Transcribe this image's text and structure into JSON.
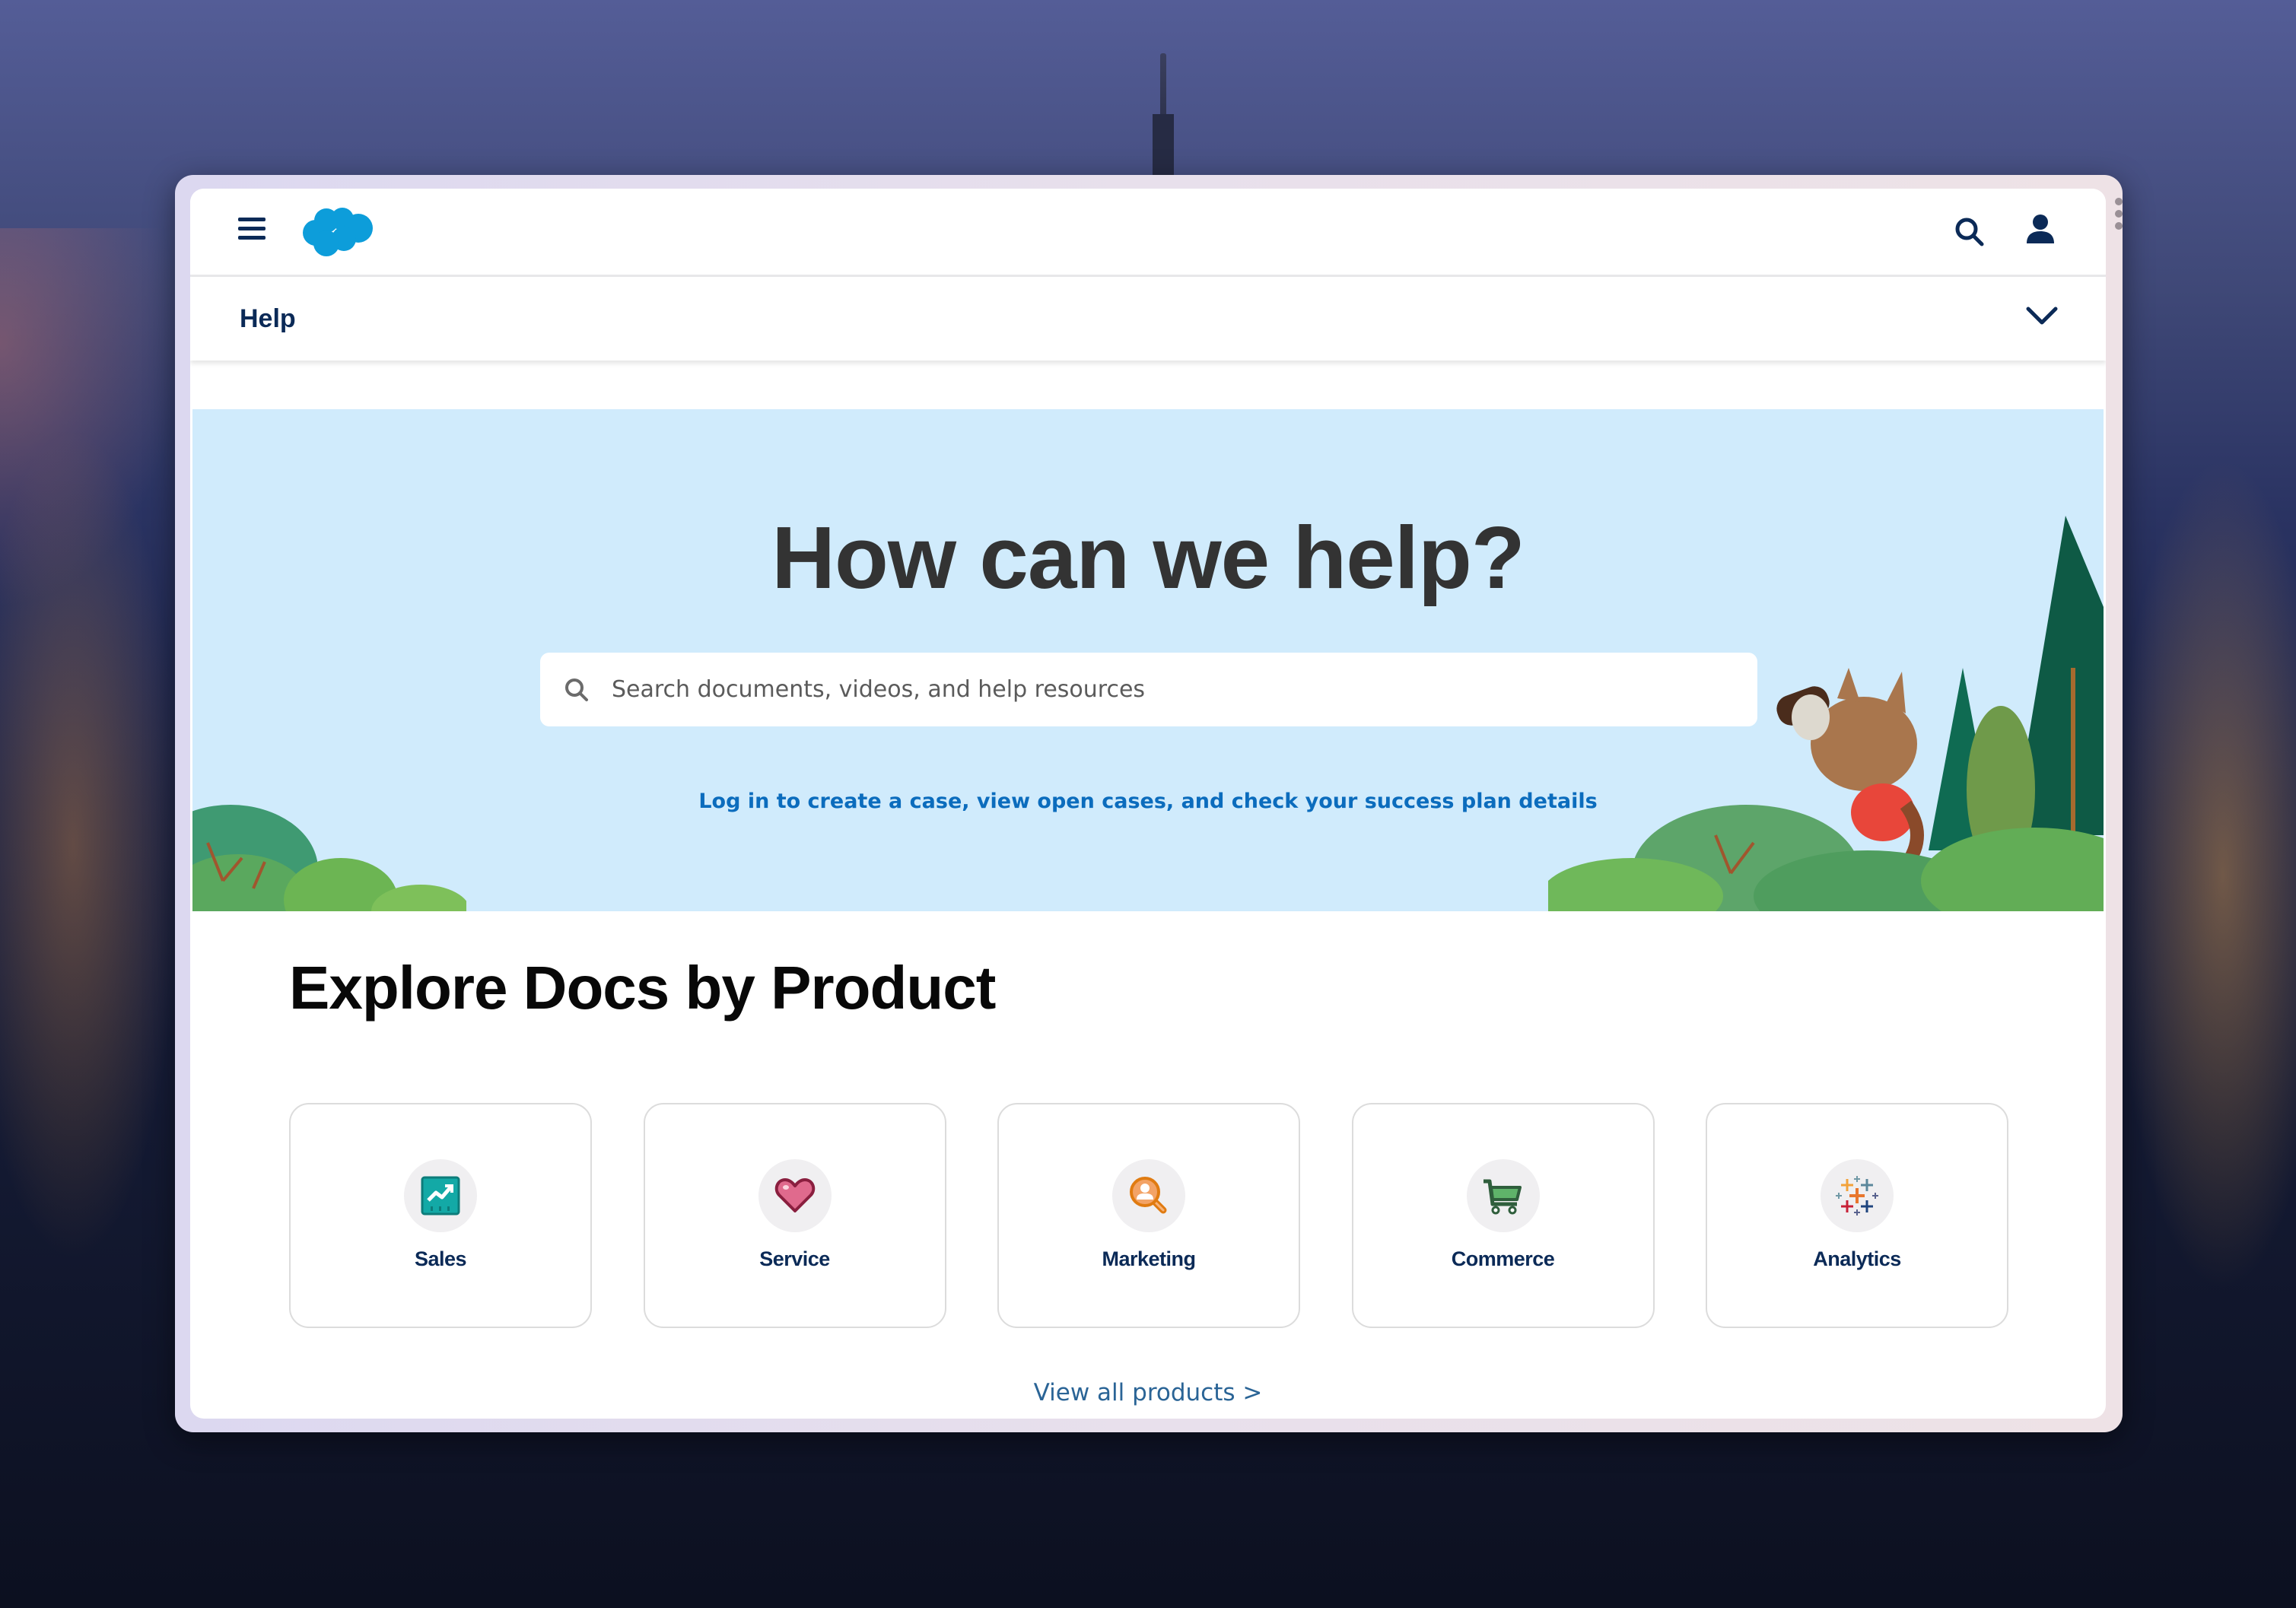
{
  "nav": {
    "menu_icon": "hamburger-menu-icon",
    "logo": "salesforce-cloud-logo",
    "search_icon": "search-icon",
    "user_icon": "user-icon"
  },
  "helpbar": {
    "label": "Help",
    "chevron_icon": "chevron-down-icon"
  },
  "hero": {
    "title": "How can we help?",
    "search_placeholder": "Search documents, videos, and help resources",
    "search_value": "",
    "login_link": "Log in to create a case, view open cases, and check your success plan details"
  },
  "explore": {
    "title": "Explore Docs by Product",
    "products": [
      {
        "label": "Sales",
        "icon": "sales-chart-icon"
      },
      {
        "label": "Service",
        "icon": "heart-icon"
      },
      {
        "label": "Marketing",
        "icon": "person-magnifier-icon"
      },
      {
        "label": "Commerce",
        "icon": "shopping-cart-icon"
      },
      {
        "label": "Analytics",
        "icon": "tableau-plus-icon"
      }
    ],
    "view_all": "View all products >"
  },
  "colors": {
    "navy": "#0b2a57",
    "brand_blue": "#0d9dda",
    "hero_bg": "#d0ebfc",
    "link_blue": "#0b6cbd",
    "view_all_blue": "#2a6496"
  }
}
